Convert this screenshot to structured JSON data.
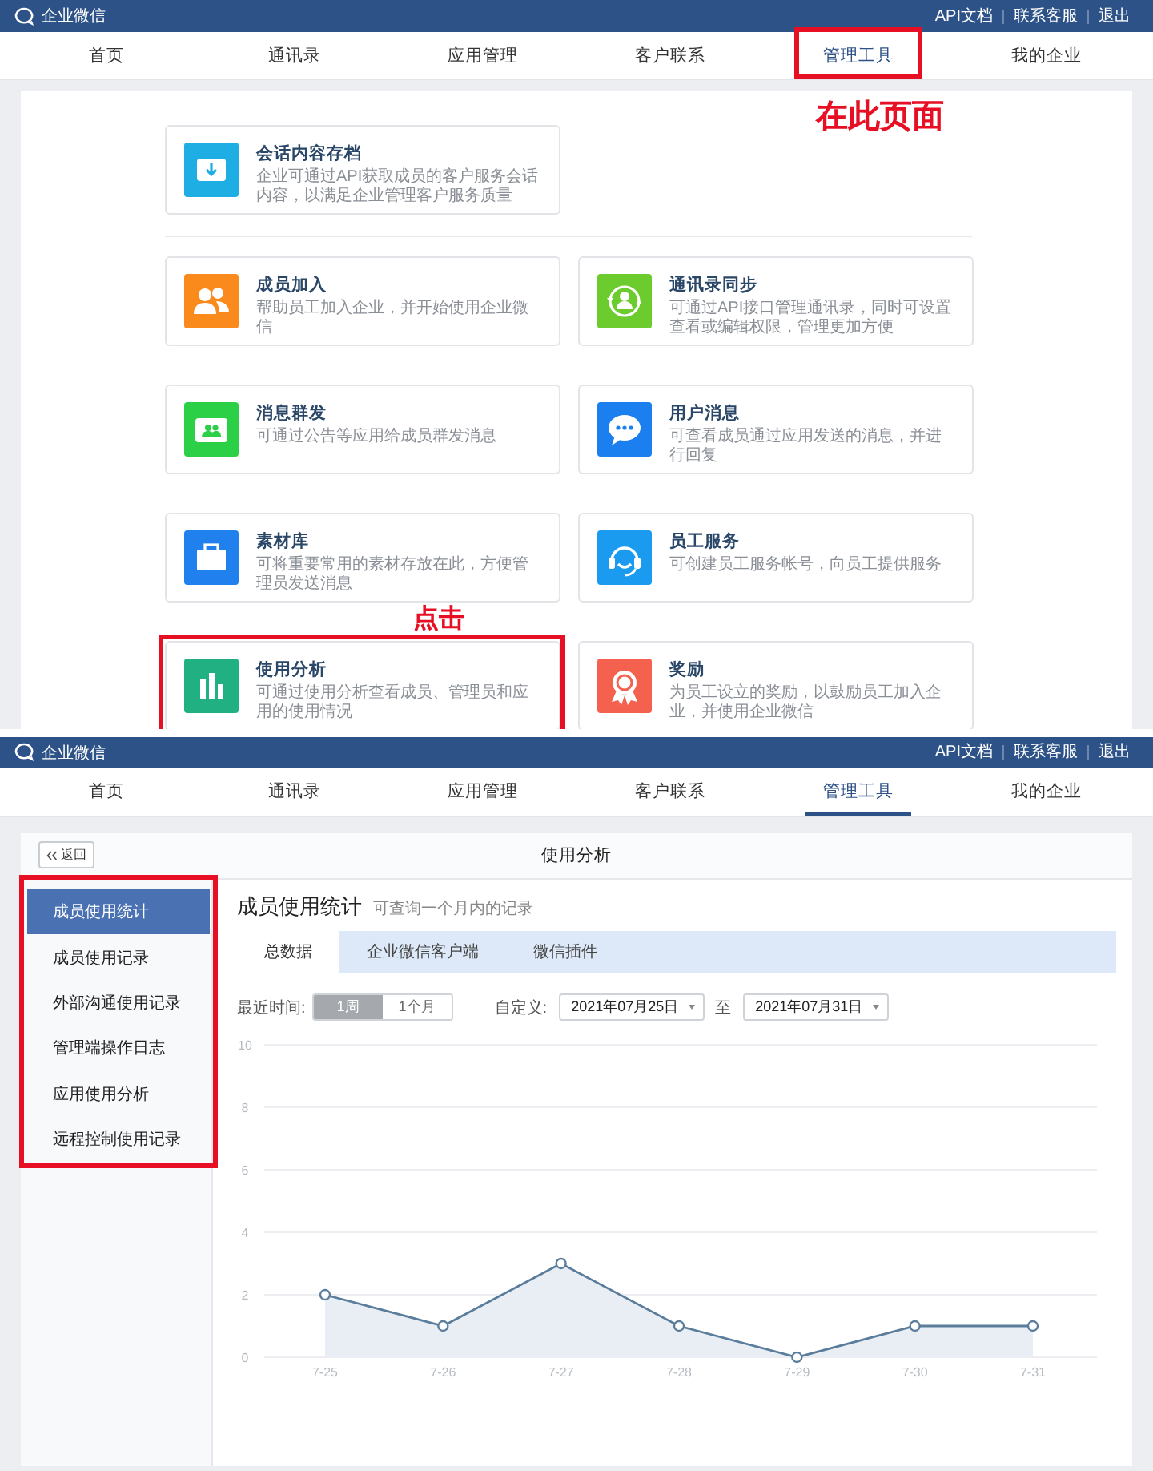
{
  "tools_screen": {
    "header": {
      "brand": "企业微信",
      "links": [
        "API文档",
        "联系客服",
        "退出"
      ]
    },
    "nav": [
      {
        "label": "首页",
        "selected": false,
        "highlighted": false
      },
      {
        "label": "通讯录",
        "selected": false,
        "highlighted": false
      },
      {
        "label": "应用管理",
        "selected": false,
        "highlighted": false
      },
      {
        "label": "客户联系",
        "selected": false,
        "highlighted": false
      },
      {
        "label": "管理工具",
        "selected": true,
        "highlighted": true,
        "callout": "在此页面"
      },
      {
        "label": "我的企业",
        "selected": false,
        "highlighted": false
      }
    ],
    "featured_card": {
      "kind": "archive",
      "color": "#1eaee3",
      "title": "会话内容存档",
      "description": "企业可通过API获取成员的客户服务会话内容，以满足企业管理客户服务质量",
      "highlighted": false
    },
    "cards": [
      {
        "kind": "members",
        "color": "#fb8a1c",
        "title": "成员加入",
        "description": "帮助员工加入企业，并开始使用企业微信",
        "highlighted": false
      },
      {
        "kind": "sync",
        "color": "#6ccc2e",
        "title": "通讯录同步",
        "description": "可通过API接口管理通讯录，同时可设置查看或编辑权限，管理更加方便",
        "highlighted": false
      },
      {
        "kind": "broadcast",
        "color": "#2cd047",
        "title": "消息群发",
        "description": "可通过公告等应用给成员群发消息",
        "highlighted": false
      },
      {
        "kind": "message",
        "color": "#1b7ff0",
        "title": "用户消息",
        "description": "可查看成员通过应用发送的消息，并进行回复",
        "highlighted": false
      },
      {
        "kind": "library",
        "color": "#1f80ee",
        "title": "素材库",
        "description": "可将重要常用的素材存放在此，方便管理员发送消息",
        "highlighted": false
      },
      {
        "kind": "service",
        "color": "#1a9bf0",
        "title": "员工服务",
        "description": "可创建员工服务帐号，向员工提供服务",
        "highlighted": false
      },
      {
        "kind": "analytics",
        "color": "#21b081",
        "title": "使用分析",
        "description": "可通过使用分析查看成员、管理员和应用的使用情况",
        "highlighted": true,
        "callout": "点击"
      },
      {
        "kind": "reward",
        "color": "#f5614f",
        "title": "奖励",
        "description": "为员工设立的奖励，以鼓励员工加入企业，并使用企业微信",
        "highlighted": false
      }
    ]
  },
  "usage_screen": {
    "header": {
      "brand": "企业微信",
      "links": [
        "API文档",
        "联系客服",
        "退出"
      ]
    },
    "nav": [
      {
        "label": "首页",
        "selected": false,
        "highlighted": false
      },
      {
        "label": "通讯录",
        "selected": false,
        "highlighted": false
      },
      {
        "label": "应用管理",
        "selected": false,
        "highlighted": false
      },
      {
        "label": "客户联系",
        "selected": false,
        "highlighted": false
      },
      {
        "label": "管理工具",
        "selected": true,
        "highlighted": false
      },
      {
        "label": "我的企业",
        "selected": false,
        "highlighted": false
      }
    ],
    "back_button": "返回",
    "page_title": "使用分析",
    "sidebar": {
      "highlighted": true,
      "items": [
        {
          "label": "成员使用统计",
          "selected": true
        },
        {
          "label": "成员使用记录",
          "selected": false
        },
        {
          "label": "外部沟通使用记录",
          "selected": false
        },
        {
          "label": "管理端操作日志",
          "selected": false
        },
        {
          "label": "应用使用分析",
          "selected": false
        },
        {
          "label": "远程控制使用记录",
          "selected": false
        }
      ]
    },
    "section": {
      "title": "成员使用统计",
      "hint": "可查询一个月内的记录"
    },
    "tabs": [
      {
        "label": "总数据",
        "selected": true
      },
      {
        "label": "企业微信客户端",
        "selected": false
      },
      {
        "label": "微信插件",
        "selected": false
      }
    ],
    "filters": {
      "recent_label": "最近时间:",
      "ranges": [
        {
          "label": "1周",
          "selected": true
        },
        {
          "label": "1个月",
          "selected": false
        }
      ],
      "custom_label": "自定义:",
      "start_date": "2021年07月25日",
      "separator": "至",
      "end_date": "2021年07月31日"
    },
    "chart_data": {
      "type": "area",
      "categories": [
        "7-25",
        "7-26",
        "7-27",
        "7-28",
        "7-29",
        "7-30",
        "7-31"
      ],
      "series": [
        {
          "color": "#5b7d9c",
          "values": [
            2,
            1,
            3,
            1,
            0,
            1,
            1
          ]
        }
      ],
      "grid": true,
      "ylim": [
        0,
        10
      ],
      "yticks": [
        0,
        2,
        4,
        6,
        8,
        10
      ]
    }
  }
}
